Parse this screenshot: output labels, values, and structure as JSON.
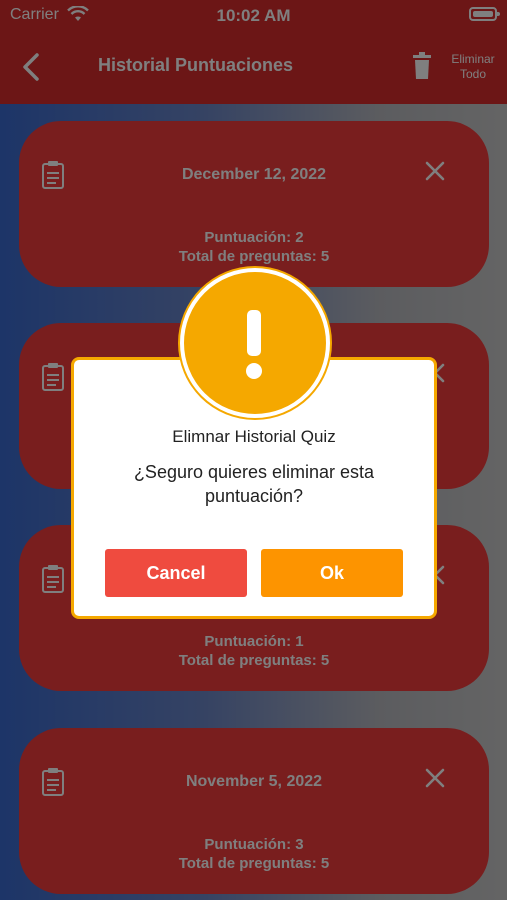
{
  "status": {
    "carrier": "Carrier",
    "time": "10:02 AM"
  },
  "nav": {
    "title": "Historial Puntuaciones",
    "delete_all": "Eliminar Todo"
  },
  "cards": [
    {
      "date": "December 12, 2022",
      "score": "Puntuación: 2",
      "total": "Total de preguntas: 5"
    },
    {
      "date": "",
      "score": "",
      "total": ""
    },
    {
      "date": "",
      "score": "Puntuación: 1",
      "total": "Total de preguntas: 5"
    },
    {
      "date": "November 5, 2022",
      "score": "Puntuación: 3",
      "total": "Total de preguntas: 5"
    }
  ],
  "alert": {
    "title": "Elimnar Historial Quiz",
    "message": "¿Seguro quieres eliminar esta puntuación?",
    "cancel": "Cancel",
    "ok": "Ok"
  },
  "colors": {
    "header": "#d92c2c",
    "card": "#f23c3c",
    "alert_accent": "#f5a800",
    "cancel": "#ef4b3f",
    "ok": "#fd9400"
  }
}
